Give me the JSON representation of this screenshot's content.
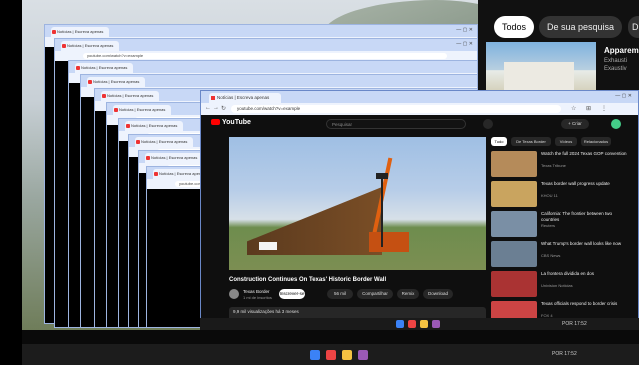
{
  "image_search": {
    "chips": [
      "Todos",
      "De sua pesquisa",
      "D"
    ],
    "panel_title": "Apparem",
    "panel_lines": [
      "Exhausti",
      "Exaustiv"
    ]
  },
  "browser": {
    "tab_title": "Notícias | Escreva apenas",
    "url": "youtube.com/watch?v=example",
    "window_controls": "—  ▢  ✕"
  },
  "youtube": {
    "logo": "YouTube",
    "search_placeholder": "Pesquisar",
    "create_label": "+ Criar",
    "video_title": "Construction Continues On Texas' Historic Border Wall",
    "channel_name": "Texas Border",
    "channel_subs": "1 mi de inscritos",
    "subscribe_label": "Inscrever-se",
    "actions": [
      "56 mil",
      "Compartilhar",
      "Remix",
      "Download"
    ],
    "stats": "9,9 mil visualizações há 3 meses",
    "filters": [
      "Tudo",
      "De Texas Border",
      "Vídeos",
      "Relacionados"
    ],
    "recommendations": [
      {
        "title": "Watch the full 2024 Texas GOP convention",
        "channel": "Texas Tribune",
        "color": "#b58b5a"
      },
      {
        "title": "Texas border wall progress update",
        "channel": "KHOU 11",
        "color": "#c9a45f"
      },
      {
        "title": "California: The frontier between two countries",
        "channel": "Reuters",
        "color": "#7a8fa5"
      },
      {
        "title": "What Trump's border wall looks like now",
        "channel": "CBS News",
        "color": "#6b7f93"
      },
      {
        "title": "La frontera dividida en dos",
        "channel": "Univision Noticias",
        "color": "#a33"
      },
      {
        "title": "Texas officials respond to border crisis",
        "channel": "FOX 4",
        "color": "#c44"
      }
    ]
  },
  "taskbar": {
    "tray_upper": "POR 17:52",
    "tray_lower": "POR  17:52"
  }
}
